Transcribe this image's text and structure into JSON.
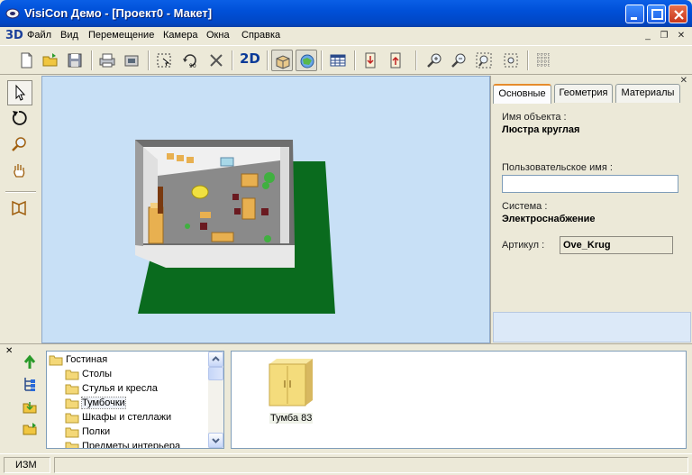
{
  "window": {
    "title": "VisiCon Демо - [Проект0 - Макет]",
    "app_icon": "visicon-logo-icon",
    "controls": [
      "minimize-icon",
      "maximize-icon",
      "close-icon"
    ]
  },
  "menubar": {
    "logo": "3D",
    "items": [
      {
        "label": "Файл"
      },
      {
        "label": "Вид"
      },
      {
        "label": "Перемещение"
      },
      {
        "label": "Камера"
      },
      {
        "label": "Окна"
      },
      {
        "label": "Справка"
      }
    ]
  },
  "toolbar": {
    "label_2d": "2D",
    "buttons": [
      "new-document-icon",
      "open-folder-icon",
      "save-icon",
      "print-icon",
      "print-preview-icon",
      "select-rect-icon",
      "rotate-90-icon",
      "delete-icon",
      "2d-view",
      "3d-box-icon",
      "3d-view-icon",
      "table-view-icon",
      "import-icon",
      "export-icon",
      "zoom-in-icon",
      "zoom-out-icon",
      "zoom-fit-icon",
      "zoom-selection-icon",
      "grid-icon"
    ]
  },
  "left_tools": [
    "pointer-icon",
    "rotate-view-icon",
    "zoom-view-icon",
    "pan-hand-icon",
    "book-view-icon"
  ],
  "properties": {
    "tabs": [
      {
        "label": "Основные",
        "active": true
      },
      {
        "label": "Геометрия",
        "active": false
      },
      {
        "label": "Материалы",
        "active": false
      }
    ],
    "object_name_label": "Имя объекта :",
    "object_name_value": "Люстра круглая",
    "custom_name_label": "Пользовательское имя :",
    "custom_name_value": "",
    "system_label": "Система :",
    "system_value": "Электроснабжение",
    "article_label": "Артикул :",
    "article_value": "Ove_Krug"
  },
  "catalog": {
    "tree": [
      {
        "label": "Гостиная",
        "level": 0,
        "open": true
      },
      {
        "label": "Столы",
        "level": 1
      },
      {
        "label": "Стулья и кресла",
        "level": 1
      },
      {
        "label": "Тумбочки",
        "level": 1,
        "selected": true
      },
      {
        "label": "Шкафы и стеллажи",
        "level": 1
      },
      {
        "label": "Полки",
        "level": 1
      },
      {
        "label": "Предметы интерьера",
        "level": 1
      }
    ],
    "items": [
      {
        "label": "Тумба 83",
        "icon": "cabinet-icon"
      }
    ]
  },
  "statusbar": {
    "mode": "ИЗМ"
  },
  "colors": {
    "titlebar": "#0050d8",
    "viewport_bg": "#c8e0f6",
    "grass": "#0a6b1e",
    "room_floor": "#888888",
    "tab_accent": "#e68b2c"
  }
}
